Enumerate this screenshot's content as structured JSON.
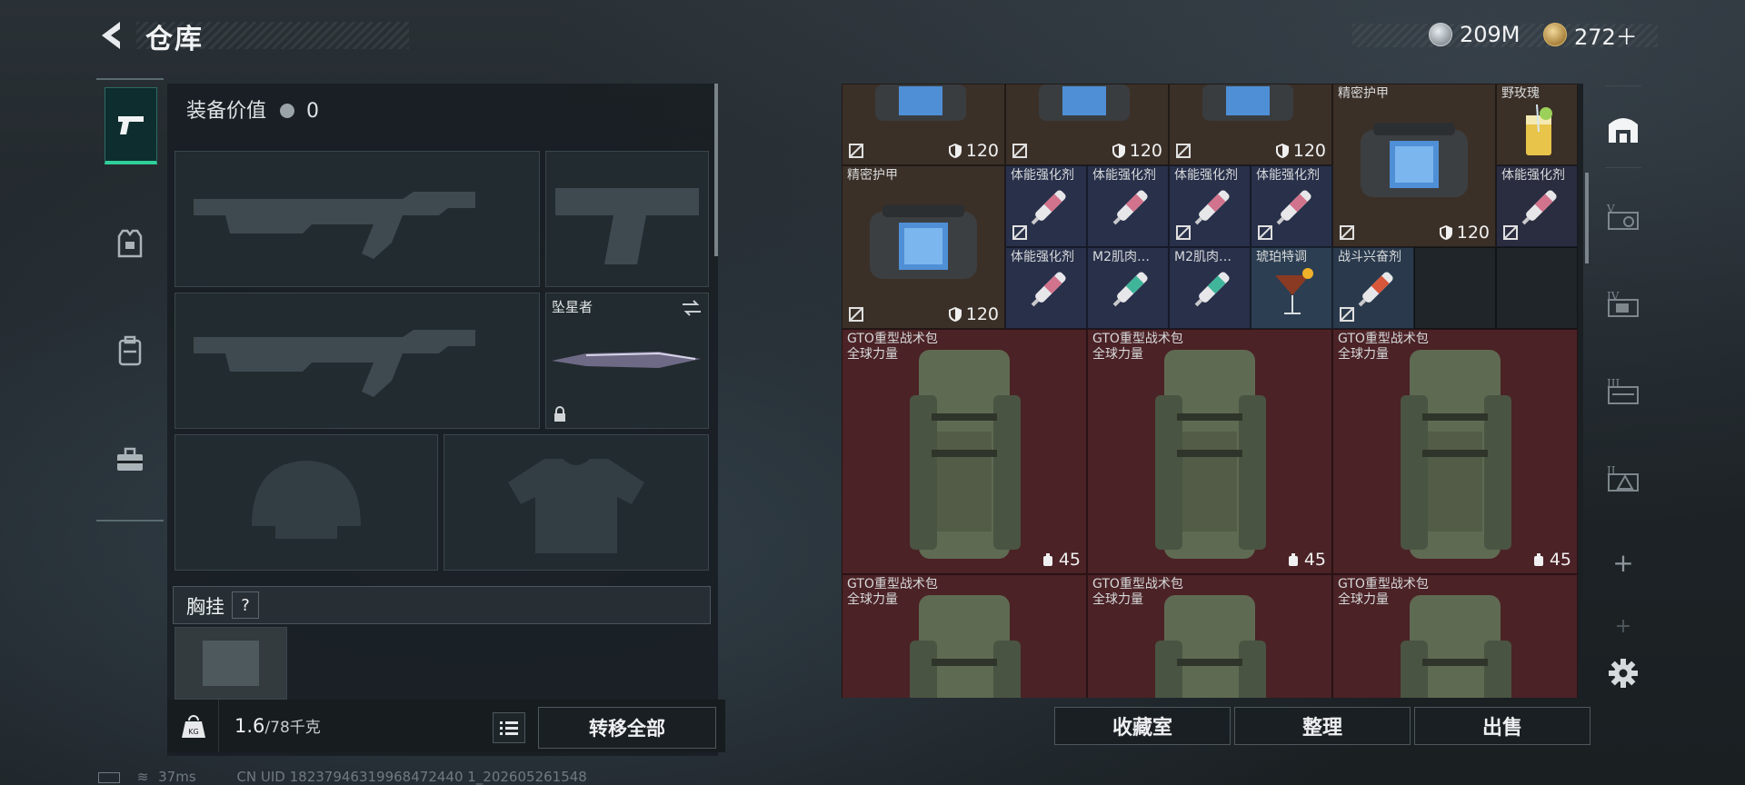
{
  "header": {
    "title": "仓库",
    "back_icon": "back-arrow-icon"
  },
  "currencies": [
    {
      "icon": "silver-coin-icon",
      "value": "209M",
      "color": "#b7bec4"
    },
    {
      "icon": "gold-coin-icon",
      "value": "272＋",
      "color": "#c9a65a"
    }
  ],
  "left_tabs": [
    {
      "icon": "pistol-icon",
      "active": true
    },
    {
      "icon": "armor-vest-icon",
      "active": false
    },
    {
      "icon": "backpack-icon",
      "active": false
    },
    {
      "icon": "toolbox-icon",
      "active": false
    }
  ],
  "loadout": {
    "equip_value_label": "装备价值",
    "equip_value": "0",
    "melee_name": "坠星者",
    "chest_rig_label": "胸挂",
    "chest_rig_help": "?",
    "weight_current": "1.6",
    "weight_max": "/78千克",
    "transfer_all": "转移全部"
  },
  "stash": {
    "rows": [
      [
        {
          "name": "",
          "val": "120",
          "kind": "armor-bag",
          "bg": "brown"
        },
        {
          "name": "",
          "val": "120",
          "kind": "armor-bag",
          "bg": "brown"
        },
        {
          "name": "",
          "val": "120",
          "kind": "armor-bag",
          "bg": "brown"
        },
        {
          "name": "精密护甲",
          "val": "120",
          "kind": "armor-bag",
          "bg": "brown"
        },
        {
          "name": "野玫瑰",
          "val": "",
          "kind": "drink",
          "bg": "brown"
        }
      ],
      [
        {
          "name": "精密护甲",
          "val": "120",
          "kind": "armor-bag",
          "bg": "brown"
        },
        {
          "name": "体能强化剂",
          "kind": "syringe",
          "bg": "blue"
        },
        {
          "name": "体能强化剂",
          "kind": "syringe",
          "bg": "blue"
        },
        {
          "name": "体能强化剂",
          "kind": "syringe",
          "bg": "blue"
        },
        {
          "name": "体能强化剂",
          "kind": "syringe",
          "bg": "blue"
        },
        {
          "name": "体能强化剂",
          "kind": "syringe",
          "bg": "blue"
        },
        {
          "name": "体能强化剂",
          "kind": "syringe",
          "bg": "blue"
        },
        {
          "name": "M2肌肉…",
          "kind": "syringe-green",
          "bg": "blue"
        },
        {
          "name": "M2肌肉…",
          "kind": "syringe-green",
          "bg": "blue"
        },
        {
          "name": "琥珀特调",
          "kind": "cocktail",
          "bg": "blue"
        },
        {
          "name": "战斗兴奋剂",
          "kind": "syringe-red",
          "bg": "blue"
        }
      ],
      [
        {
          "name": "GTO重型战术包",
          "sub": "全球力量",
          "val": "45",
          "kind": "backpack",
          "bg": "red"
        },
        {
          "name": "GTO重型战术包",
          "sub": "全球力量",
          "val": "45",
          "kind": "backpack",
          "bg": "red"
        },
        {
          "name": "GTO重型战术包",
          "sub": "全球力量",
          "val": "45",
          "kind": "backpack",
          "bg": "red"
        },
        {
          "name": "GTO重型战术包",
          "sub": "全球力量",
          "val": "",
          "kind": "backpack",
          "bg": "red"
        },
        {
          "name": "GTO重型战术包",
          "sub": "全球力量",
          "val": "",
          "kind": "backpack",
          "bg": "red"
        },
        {
          "name": "GTO重型战术包",
          "sub": "全球力量",
          "val": "",
          "kind": "backpack",
          "bg": "red"
        }
      ]
    ],
    "buttons": {
      "collection": "收藏室",
      "sort": "整理",
      "sell": "出售"
    }
  },
  "right_tabs": [
    "warehouse-icon",
    "stash-v-icon",
    "stash-iv-icon",
    "stash-iii-icon",
    "stash-ii-icon",
    "add-icon",
    "add-icon-disabled",
    "settings-gear-icon"
  ],
  "status_bar": {
    "ping": "37ms",
    "uid": "CN UID 18237946319968472440 1_202605261548"
  }
}
